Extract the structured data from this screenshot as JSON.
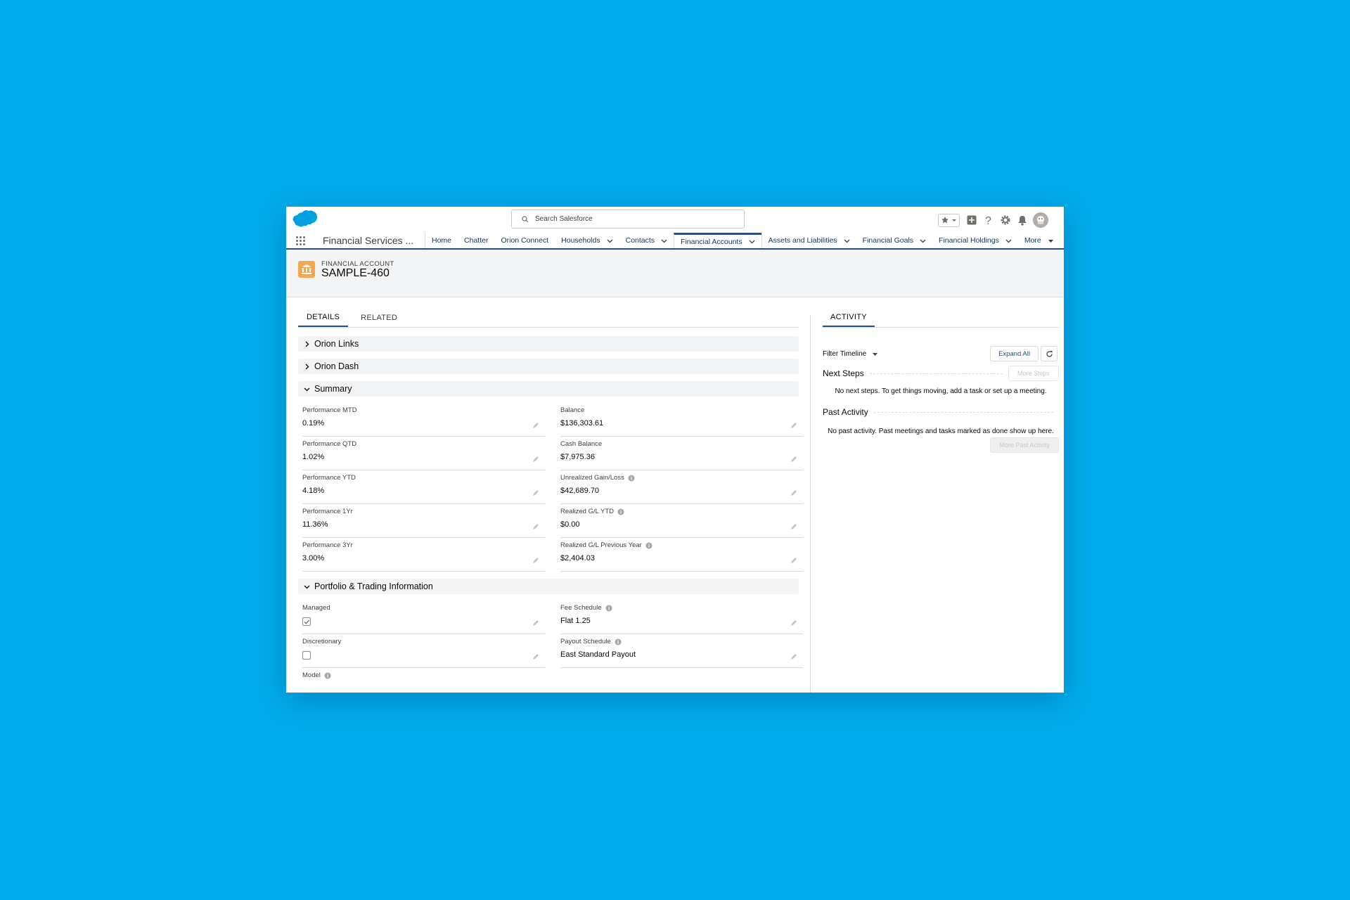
{
  "search": {
    "placeholder": "Search Salesforce"
  },
  "app": {
    "name": "Financial Services ..."
  },
  "nav": {
    "tabs": [
      {
        "label": "Home"
      },
      {
        "label": "Chatter"
      },
      {
        "label": "Orion Connect"
      },
      {
        "label": "Households"
      },
      {
        "label": "Contacts"
      },
      {
        "label": "Financial Accounts"
      },
      {
        "label": "Assets and Liabilities"
      },
      {
        "label": "Financial Goals"
      },
      {
        "label": "Financial Holdings"
      },
      {
        "label": "More"
      }
    ]
  },
  "record": {
    "type": "FINANCIAL ACCOUNT",
    "title": "SAMPLE-460"
  },
  "record_tabs": {
    "details": "DETAILS",
    "related": "RELATED"
  },
  "sections": {
    "orion_links": "Orion Links",
    "orion_dash": "Orion Dash",
    "summary": "Summary",
    "portfolio": "Portfolio & Trading Information"
  },
  "summary": {
    "left": [
      {
        "label": "Performance MTD",
        "value": "0.19%"
      },
      {
        "label": "Performance QTD",
        "value": "1.02%"
      },
      {
        "label": "Performance YTD",
        "value": "4.18%"
      },
      {
        "label": "Performance 1Yr",
        "value": "11.36%"
      },
      {
        "label": "Performance 3Yr",
        "value": "3.00%"
      }
    ],
    "right": [
      {
        "label": "Balance",
        "value": "$136,303.61"
      },
      {
        "label": "Cash Balance",
        "value": "$7,975.36"
      },
      {
        "label": "Unrealized Gain/Loss",
        "value": "$42,689.70"
      },
      {
        "label": "Realized G/L YTD",
        "value": "$0.00"
      },
      {
        "label": "Realized G/L Previous Year",
        "value": "$2,404.03"
      }
    ]
  },
  "portfolio": {
    "managed": {
      "label": "Managed",
      "checked": true
    },
    "discretionary": {
      "label": "Discretionary",
      "checked": false
    },
    "model": {
      "label": "Model"
    },
    "fee_schedule": {
      "label": "Fee Schedule",
      "value": "Flat 1.25"
    },
    "payout_schedule": {
      "label": "Payout Schedule",
      "value": "East Standard Payout"
    }
  },
  "activity": {
    "tab": "ACTIVITY",
    "filter": "Filter Timeline",
    "expand_all": "Expand All",
    "next_steps": "Next Steps",
    "more_steps": "More Steps",
    "next_empty": "No next steps. To get things moving, add a task or set up a meeting.",
    "past_activity": "Past Activity",
    "past_empty": "No past activity. Past meetings and tasks marked as done show up here.",
    "more_past": "More Past Activity"
  },
  "colors": {
    "background": "#00acec",
    "brand": "#1b5297",
    "account_icon": "#f2a851",
    "logo": "#00a1e0"
  }
}
